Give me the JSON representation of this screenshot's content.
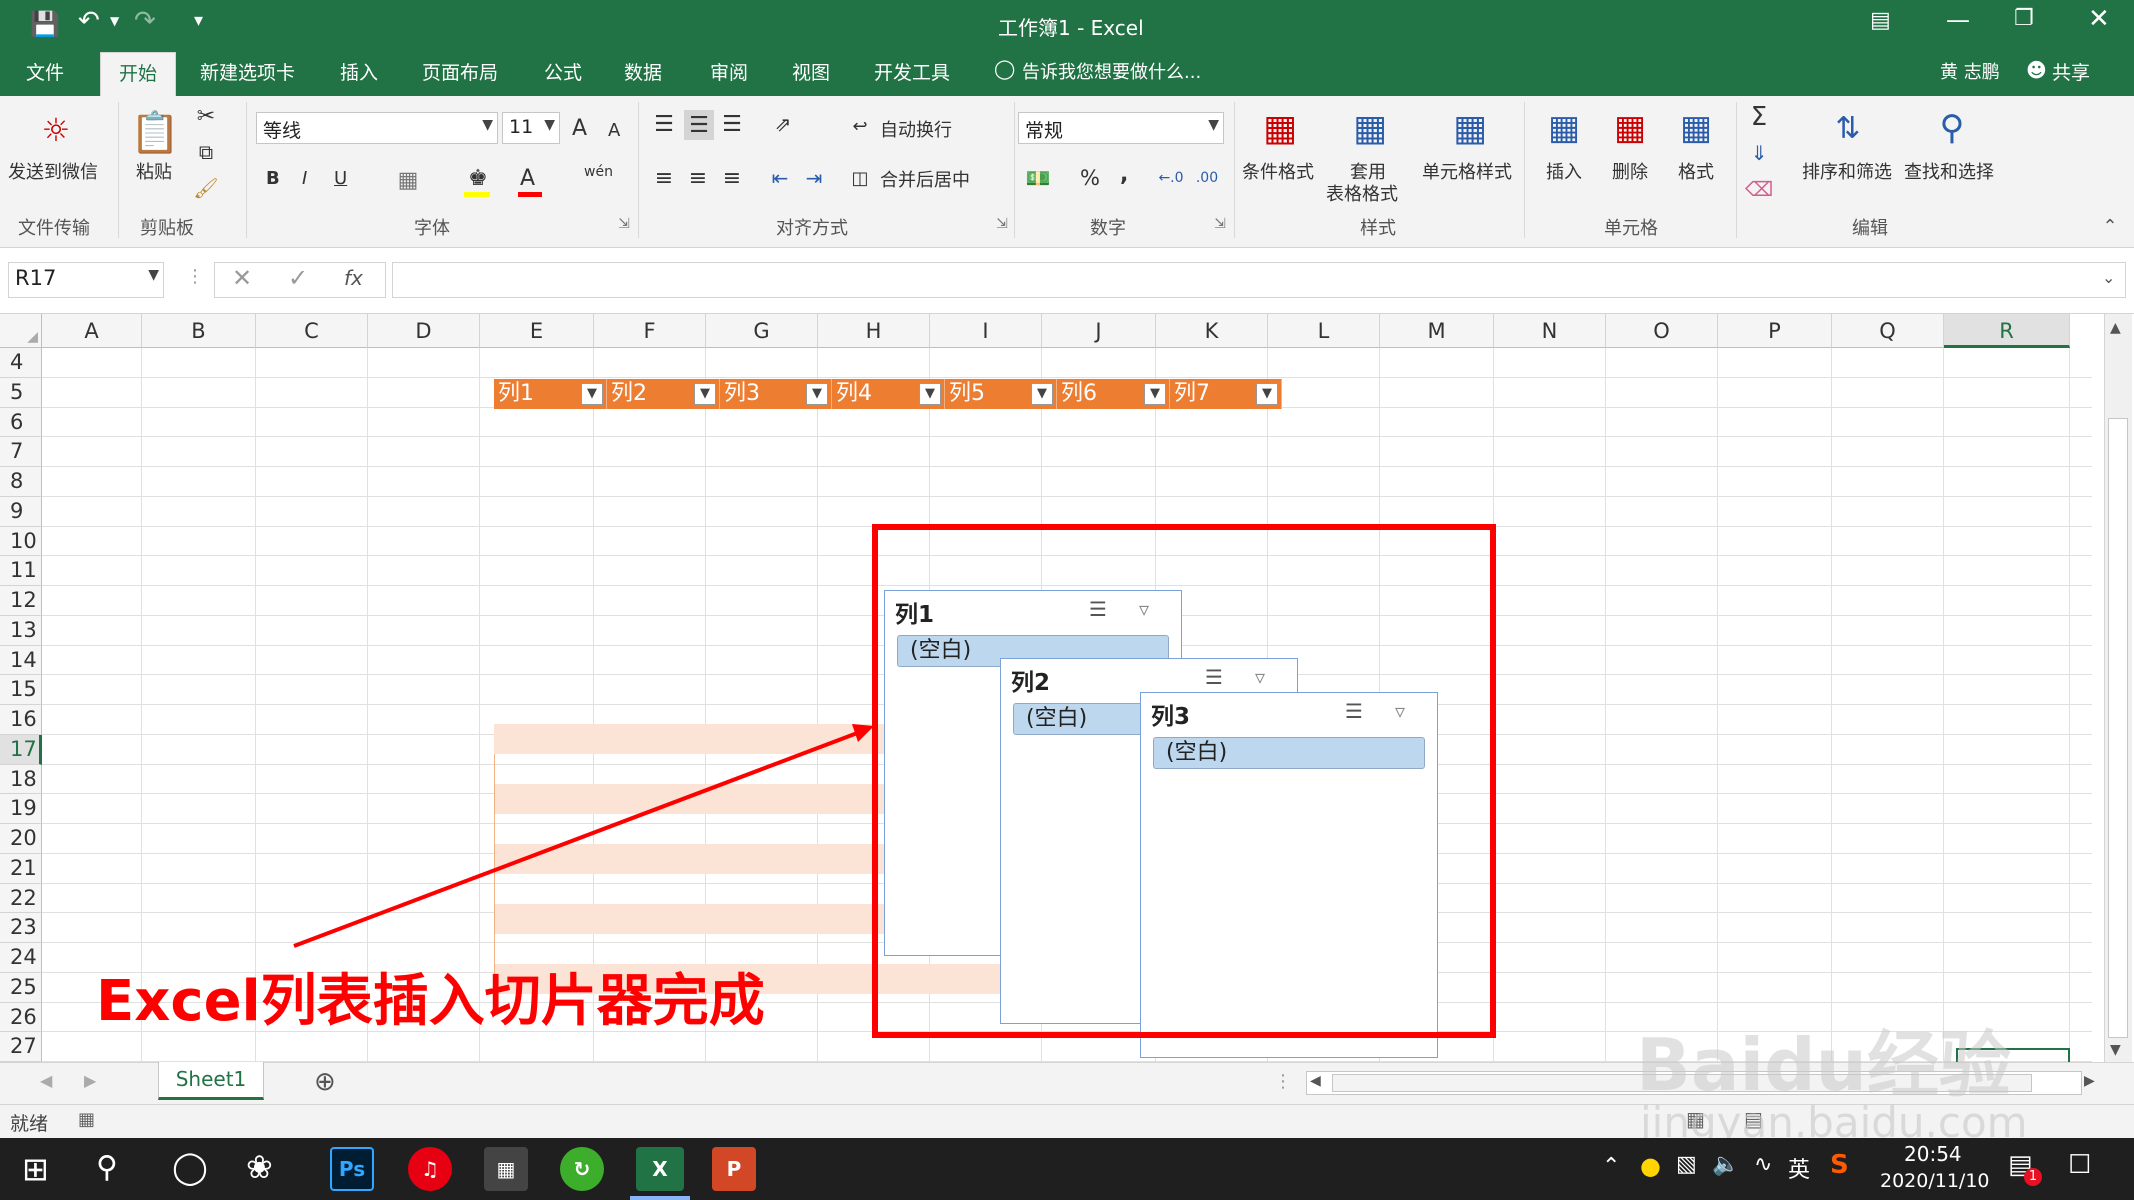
{
  "window": {
    "title": "工作簿1 - Excel",
    "user": "黄 志鹏",
    "share": "共享"
  },
  "tabs": [
    "文件",
    "开始",
    "新建选项卡",
    "插入",
    "页面布局",
    "公式",
    "数据",
    "审阅",
    "视图",
    "开发工具"
  ],
  "tell_me": "告诉我您想要做什么...",
  "ribbon": {
    "wechat": "发送到微信",
    "g_transfer": "文件传输",
    "paste": "粘贴",
    "g_clipboard": "剪贴板",
    "font_name": "等线",
    "font_size": "11",
    "g_font": "字体",
    "bold": "B",
    "italic": "I",
    "underline": "U",
    "font_a": "A",
    "grow": "A",
    "shrink": "A",
    "phonetic": "wén",
    "wrap": "自动换行",
    "merge": "合并后居中",
    "g_align": "对齐方式",
    "number_format": "常规",
    "g_number": "数字",
    "percent": "%",
    "comma": ",",
    "cond_format": "条件格式",
    "table_format_1": "套用",
    "table_format_2": "表格格式",
    "cell_style": "单元格样式",
    "g_styles": "样式",
    "insert": "插入",
    "delete": "删除",
    "format": "格式",
    "g_cells": "单元格",
    "sort": "排序和筛选",
    "find": "查找和选择",
    "g_edit": "编辑"
  },
  "formula": {
    "name_box": "R17",
    "fx": "fx",
    "value": ""
  },
  "columns": [
    "A",
    "B",
    "C",
    "D",
    "E",
    "F",
    "G",
    "H",
    "I",
    "J",
    "K",
    "L",
    "M",
    "N",
    "O",
    "P",
    "Q",
    "R"
  ],
  "rows": [
    "4",
    "5",
    "6",
    "7",
    "8",
    "9",
    "10",
    "11",
    "12",
    "13",
    "14",
    "15",
    "16",
    "17",
    "18",
    "19",
    "20",
    "21",
    "22",
    "23",
    "24",
    "25",
    "26",
    "27"
  ],
  "table_headers": [
    "列1",
    "列2",
    "列3",
    "列4",
    "列5",
    "列6",
    "列7"
  ],
  "slicers": [
    {
      "title": "列1",
      "item": "(空白)"
    },
    {
      "title": "列2",
      "item": "(空白)"
    },
    {
      "title": "列3",
      "item": "(空白)"
    }
  ],
  "annotation": "Excel列表插入切片器完成",
  "sheet_tab": "Sheet1",
  "status": "就绪",
  "watermark": "Baidu经验",
  "watermark_url": "jingyan.baidu.com",
  "taskbar": {
    "time": "20:54",
    "date": "2020/11/10",
    "ime": "英",
    "badge": "1"
  },
  "colors": {
    "excel_green": "#217346",
    "table_orange": "#ed7d31",
    "band": "#fbe4d5",
    "annotation_red": "#ff0000",
    "slicer_item": "#bdd7ee"
  }
}
